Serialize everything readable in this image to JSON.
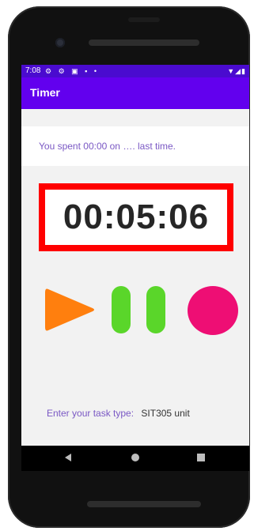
{
  "status_bar": {
    "time": "7:08",
    "left_icons": "⚙ ⚙ ▣ ▪ •",
    "right_icons": "▼◢▮",
    "color": "#4a0bcf"
  },
  "app_bar": {
    "title": "Timer",
    "color": "#6200ee"
  },
  "last_time": {
    "text": "You spent 00:00 on …. last time."
  },
  "timer": {
    "display": "00:05:06",
    "border_color": "#ff0000"
  },
  "controls": {
    "play": {
      "icon": "play-icon",
      "color": "#ff7f0e"
    },
    "pause": {
      "icon": "pause-icon",
      "color": "#5ad62a"
    },
    "stop": {
      "icon": "stop-icon",
      "color": "#ee0e74"
    }
  },
  "task": {
    "label": "Enter your task type:",
    "value": "SIT305 unit"
  },
  "nav": {
    "back": "back-icon",
    "home": "home-icon",
    "recents": "recents-icon"
  }
}
